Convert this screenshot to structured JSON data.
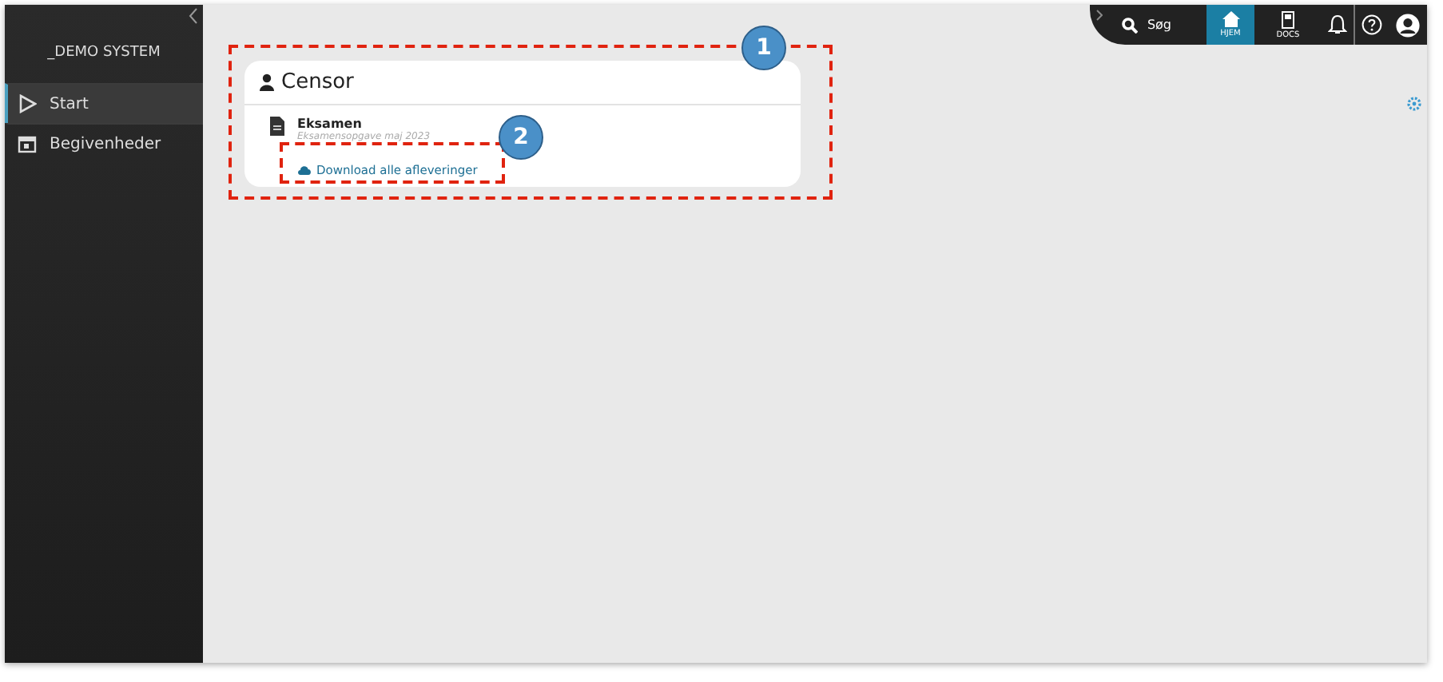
{
  "sidebar": {
    "title": "_DEMO SYSTEM",
    "items": [
      {
        "label": "Start",
        "kind": "play",
        "selected": true
      },
      {
        "label": "Begivenheder",
        "kind": "calendar",
        "selected": false
      }
    ]
  },
  "top_bar": {
    "search": {
      "label": "Søg"
    },
    "tabs": [
      {
        "label": "HJEM",
        "kind": "home",
        "selected": true
      },
      {
        "label": "DOCS",
        "kind": "docs",
        "selected": false
      }
    ]
  },
  "card": {
    "title": "Censor",
    "entry": {
      "title": "Eksamen",
      "subtitle": "Eksamensopgave maj 2023",
      "link": "Download alle afleveringer"
    }
  },
  "annotations": [
    {
      "number": "1"
    },
    {
      "number": "2"
    }
  ]
}
